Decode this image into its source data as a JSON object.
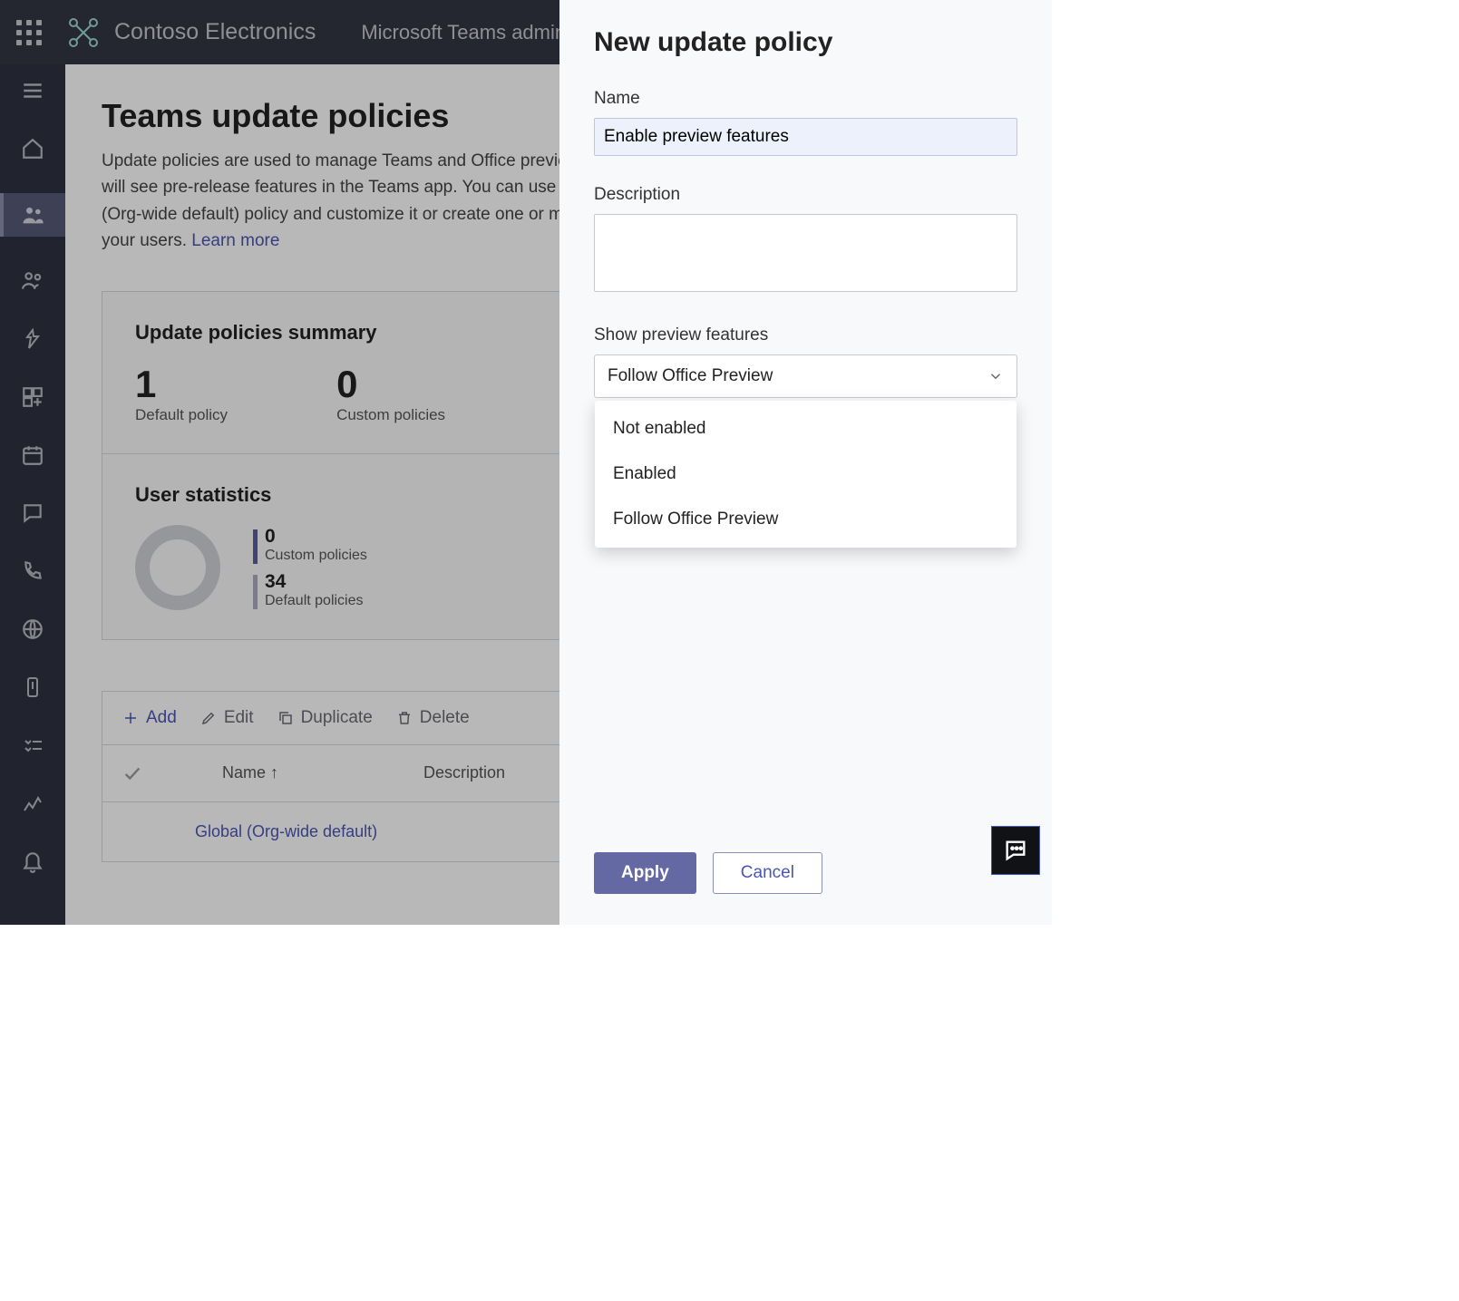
{
  "header": {
    "brand": "Contoso Electronics",
    "tenant": "Microsoft Teams admin center"
  },
  "main": {
    "page_title": "Teams update policies",
    "page_desc": "Update policies are used to manage Teams and Office preview users that will see pre-release features in the Teams app. You can use the Global (Org-wide default) policy and customize it or create one or more policies for your users. ",
    "learn_more": "Learn more",
    "summary_title": "Update policies summary",
    "summary": [
      {
        "value": "1",
        "label": "Default policy"
      },
      {
        "value": "0",
        "label": "Custom policies"
      }
    ],
    "user_stats_title": "User statistics",
    "user_stats": [
      {
        "value": "0",
        "label": "Custom policies"
      },
      {
        "value": "34",
        "label": "Default policies"
      }
    ],
    "actions": {
      "add": "Add",
      "edit": "Edit",
      "duplicate": "Duplicate",
      "delete": "Delete"
    },
    "table_head_name": "Name ↑",
    "table_head_desc": "Description",
    "row_name": "Global (Org-wide default)"
  },
  "panel": {
    "title": "New update policy",
    "name_label": "Name",
    "name_value": "Enable preview features",
    "desc_label": "Description",
    "desc_value": "",
    "preview_label": "Show preview features",
    "preview_selected": "Follow Office Preview",
    "options": [
      "Not enabled",
      "Enabled",
      "Follow Office Preview"
    ],
    "apply": "Apply",
    "cancel": "Cancel"
  }
}
